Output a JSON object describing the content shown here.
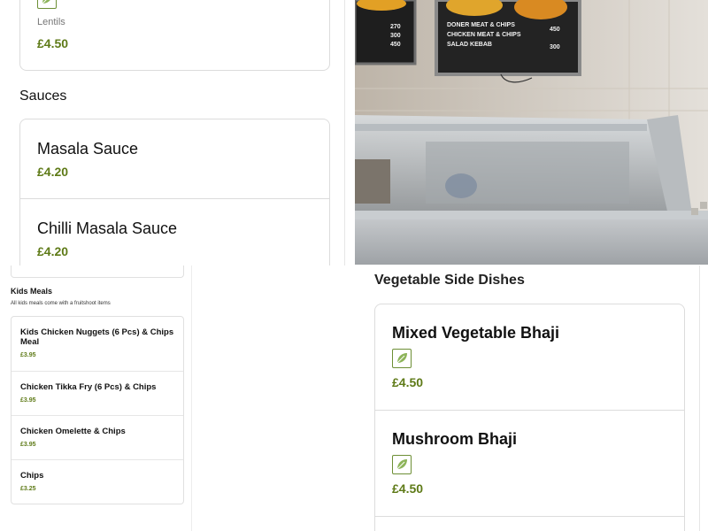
{
  "top_left": {
    "lentils": {
      "desc": "Lentils",
      "price": "£4.50",
      "icon": "leaf-icon"
    },
    "sauces_title": "Sauces",
    "sauces": [
      {
        "name": "Masala Sauce",
        "price": "£4.20"
      },
      {
        "name": "Chilli Masala Sauce",
        "price": "£4.20"
      }
    ]
  },
  "photo": {
    "board_left": [
      "270",
      "300",
      "450"
    ],
    "board_right_items": [
      "DONER MEAT & CHIPS",
      "CHICKEN MEAT & CHIPS",
      "SALAD KEBAB"
    ],
    "board_right_prices": [
      "450",
      "300"
    ]
  },
  "kids_meals": {
    "title": "Kids Meals",
    "desc": "All kids meals come with a fruitshoot items",
    "items": [
      {
        "name": "Kids Chicken Nuggets (6 Pcs) & Chips Meal",
        "price": "£3.95"
      },
      {
        "name": "Chicken Tikka Fry (6 Pcs) & Chips",
        "price": "£3.95"
      },
      {
        "name": "Chicken Omelette & Chips",
        "price": "£3.95"
      },
      {
        "name": "Chips",
        "price": "£3.25"
      }
    ]
  },
  "veg_sides": {
    "title": "Vegetable Side Dishes",
    "items": [
      {
        "name": "Mixed Vegetable Bhaji",
        "price": "£4.50",
        "icon": "leaf-icon"
      },
      {
        "name": "Mushroom Bhaji",
        "price": "£4.50",
        "icon": "leaf-icon"
      }
    ]
  },
  "colors": {
    "price": "#5e7a17",
    "leaf": "#6d8f35"
  }
}
